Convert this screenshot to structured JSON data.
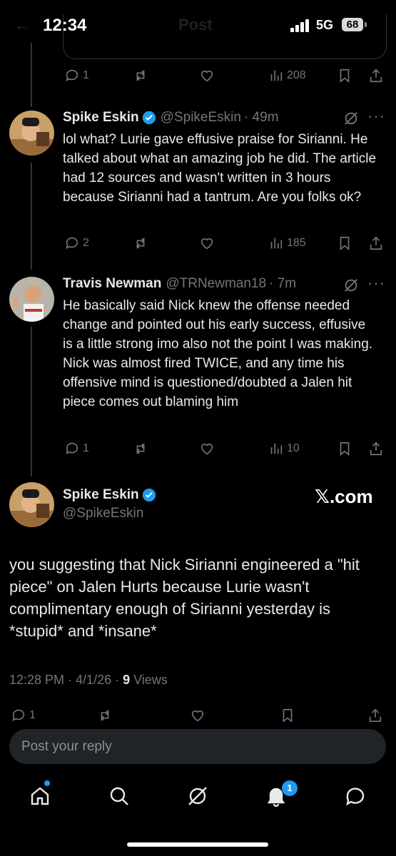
{
  "status_bar": {
    "time": "12:34",
    "network": "5G",
    "battery": "68"
  },
  "header": {
    "title": "Post"
  },
  "top_quote_actions": {
    "replies": "1",
    "views": "208"
  },
  "tweets": [
    {
      "name": "Spike Eskin",
      "handle": "@SpikeEskin",
      "time": "· 49m",
      "body": "lol what? Lurie gave effusive praise for Sirianni. He talked about what an amazing job he did. The article had 12 sources and wasn't written in 3 hours because Sirianni had a tantrum. Are you folks ok?",
      "replies": "2",
      "views": "185"
    },
    {
      "name": "Travis Newman",
      "handle": "@TRNewman18",
      "time": "· 7m",
      "body": "He basically said Nick knew the offense needed change and pointed out his early success, effusive is a little strong imo also not the point I was making. Nick was almost fired TWICE, and any time his offensive mind is questioned/doubted a Jalen hit piece comes out blaming him",
      "replies": "1",
      "views": "10"
    }
  ],
  "main_tweet": {
    "name": "Spike Eskin",
    "handle": "@SpikeEskin",
    "source": "𝕏.com",
    "body": "you suggesting that Nick Sirianni engineered a \"hit piece\" on Jalen Hurts because Lurie wasn't complimentary enough of Sirianni yesterday is *stupid* and *insane*",
    "time": "12:28 PM · 4/1/26 · ",
    "views_count": "9",
    "views_label": " Views",
    "replies": "1"
  },
  "reply": {
    "placeholder": "Post your reply"
  },
  "tabbar": {
    "notifications_badge": "1"
  },
  "colors": {
    "background": "#000000",
    "text": "#e7e9ea",
    "muted": "#71767b",
    "accent": "#1d9bf0"
  }
}
